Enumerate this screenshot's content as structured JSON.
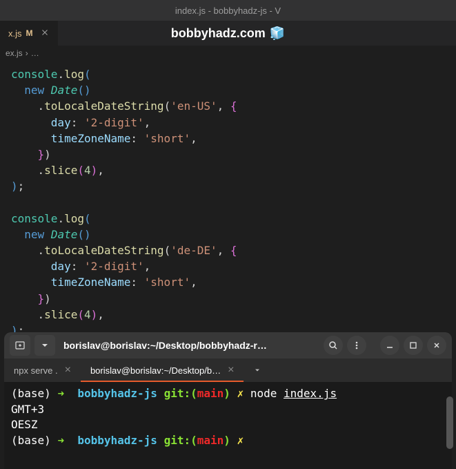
{
  "titlebar": "index.js - bobbyhadz-js - V",
  "tab": {
    "name": "x.js",
    "modified": "M"
  },
  "watermark": {
    "text": "bobbyhadz.com",
    "icon": "🧊"
  },
  "breadcrumb": {
    "file": "ex.js",
    "sep": "›",
    "rest": "…"
  },
  "code": {
    "c1": {
      "obj": "console",
      "fn": "log"
    },
    "new": "new",
    "date": "Date",
    "locale1": {
      "fn": "toLocaleDateString",
      "arg": "'en-US'"
    },
    "locale2": {
      "fn": "toLocaleDateString",
      "arg": "'de-DE'"
    },
    "day": {
      "key": "day",
      "val": "'2-digit'"
    },
    "tz": {
      "key": "timeZoneName",
      "val": "'short'"
    },
    "slice": {
      "fn": "slice",
      "arg": "4"
    }
  },
  "terminal": {
    "title": "borislav@borislav:~/Desktop/bobbyhadz-r…",
    "tabs": {
      "t1": "npx serve .",
      "t2": "borislav@borislav:~/Desktop/b…"
    },
    "prefix": "(base)",
    "arrow": "➜",
    "dir": "bobbyhadz-js",
    "git": "git:(",
    "branch": "main",
    "gitclose": ")",
    "x": "✗",
    "cmd": "node",
    "file": "index.js",
    "out1": "GMT+3",
    "out2": "OESZ"
  }
}
